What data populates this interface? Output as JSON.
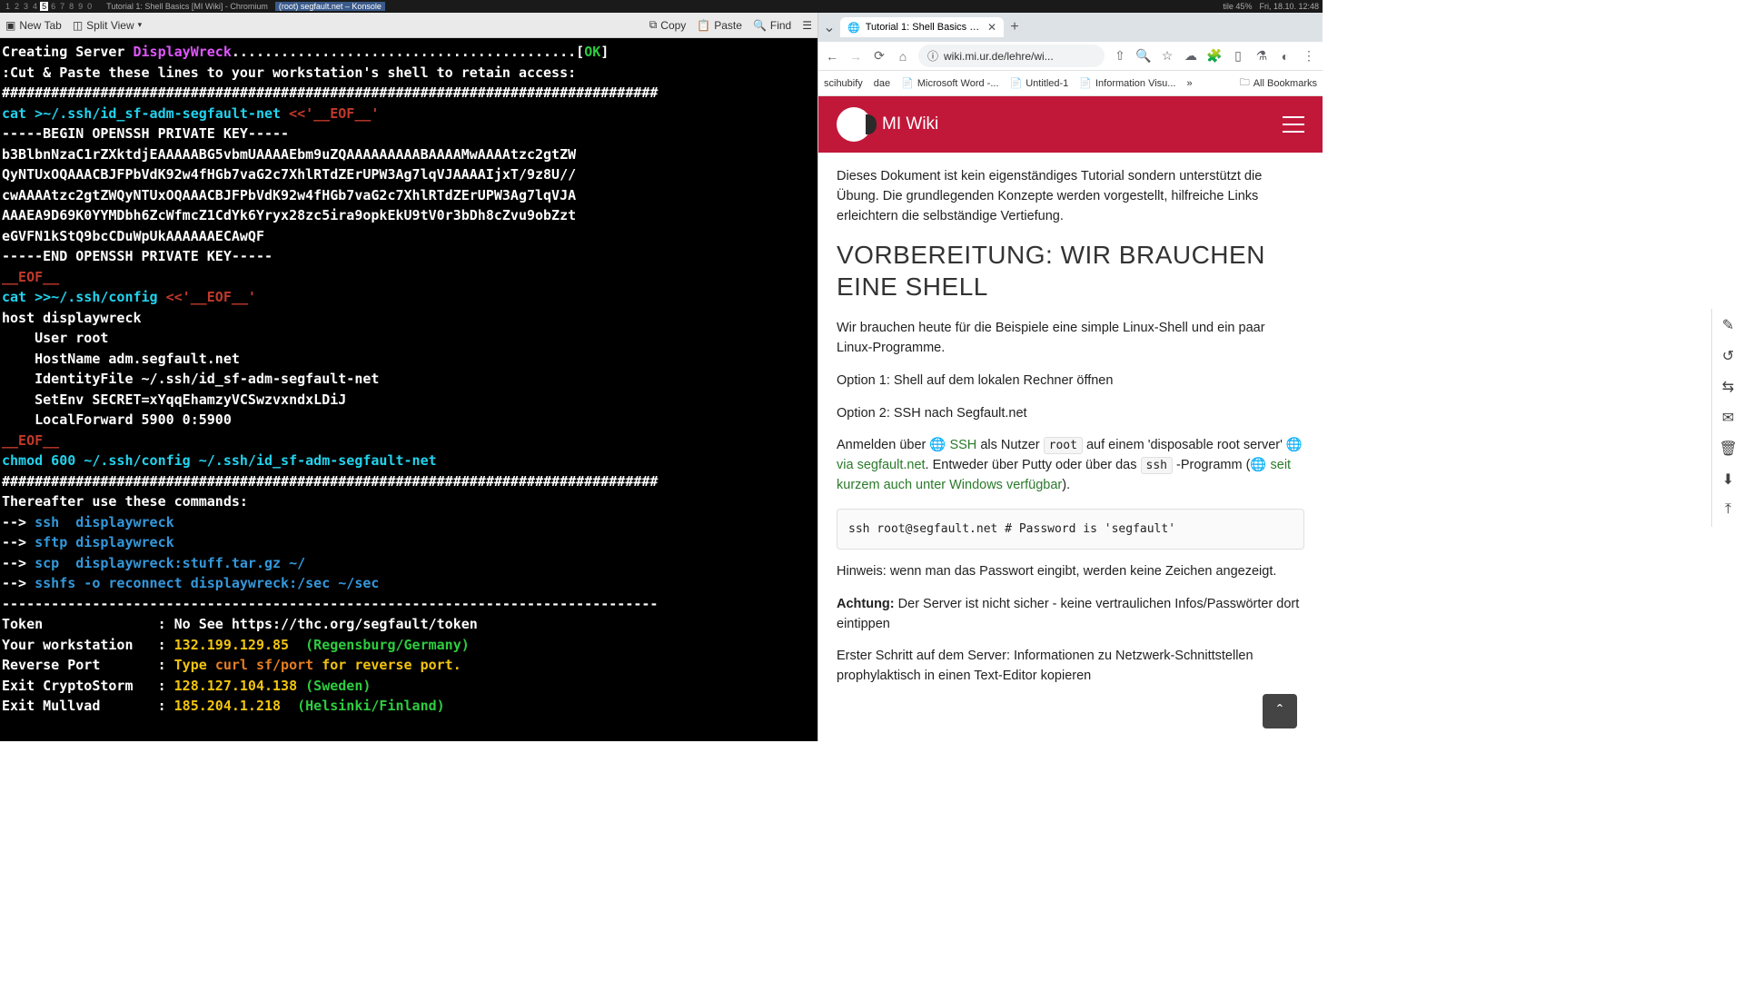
{
  "topbar": {
    "workspaces": [
      "1",
      "2",
      "3",
      "4",
      "5",
      "6",
      "7",
      "8",
      "9",
      "0"
    ],
    "active_workspace": 4,
    "tabs": [
      "Tutorial 1: Shell Basics [MI Wiki] - Chromium",
      "(root) segfault.net – Konsole"
    ],
    "right": [
      "tile 45%",
      "Fri, 18.10. 12:48"
    ]
  },
  "konsole": {
    "toolbar": {
      "new_tab": "New Tab",
      "split": "Split View",
      "copy": "Copy",
      "paste": "Paste",
      "find": "Find"
    }
  },
  "terminal": {
    "l1_a": "Creating Server ",
    "l1_b": "DisplayWreck",
    "l1_c": "..........................................[",
    "l1_d": "OK",
    "l1_e": "]",
    "l2": ":Cut & Paste these lines to your workstation's shell to retain access:",
    "hash": "################################################################################",
    "l4_a": "cat >~/.ssh/id_sf-adm-segfault-net ",
    "l4_b": "<<'__EOF__'",
    "l5": "-----BEGIN OPENSSH PRIVATE KEY-----",
    "l6": "b3BlbnNzaC1rZXktdjEAAAAABG5vbmUAAAAEbm9uZQAAAAAAAAABAAAAMwAAAAtzc2gtZW",
    "l7": "QyNTUxOQAAACBJFPbVdK92w4fHGb7vaG2c7XhlRTdZErUPW3Ag7lqVJAAAAIjxT/9z8U//",
    "l8": "cwAAAAtzc2gtZWQyNTUxOQAAACBJFPbVdK92w4fHGb7vaG2c7XhlRTdZErUPW3Ag7lqVJA",
    "l9": "AAAEA9D69K0YYMDbh6ZcWfmcZ1CdYk6Yryx28zc5ira9opkEkU9tV0r3bDh8cZvu9obZzt",
    "l10": "eGVFN1kStQ9bcCDuWpUkAAAAAAECAwQF",
    "l11": "-----END OPENSSH PRIVATE KEY-----",
    "eof": "__EOF__",
    "l13_a": "cat >>~/.ssh/config ",
    "l13_b": "<<'__EOF__'",
    "l14": "host displaywreck",
    "l15": "    User root",
    "l16": "    HostName adm.segfault.net",
    "l17": "    IdentityFile ~/.ssh/id_sf-adm-segfault-net",
    "l18": "    SetEnv SECRET=xYqqEhamzyVCSwzvxndxLDiJ",
    "l19": "    LocalForward 5900 0:5900",
    "l21": "chmod 600 ~/.ssh/config ~/.ssh/id_sf-adm-segfault-net",
    "l23": "Thereafter use these commands:",
    "arrow": "--> ",
    "l24": "ssh  displaywreck",
    "l25": "sftp displaywreck",
    "l26": "scp  displaywreck:stuff.tar.gz ~/",
    "l27": "sshfs -o reconnect displaywreck:/sec ~/sec",
    "dash": "--------------------------------------------------------------------------------",
    "token_k": "Token              : ",
    "token_v": "No See https://thc.org/segfault/token",
    "ws_k": "Your workstation   : ",
    "ws_ip": "132.199.129.85",
    "ws_loc": "  (Regensburg/Germany)",
    "rp_k": "Reverse Port       : ",
    "rp_a": "Type ",
    "rp_b": "curl sf/port",
    "rp_c": " for reverse port.",
    "ec_k": "Exit CryptoStorm   : ",
    "ec_ip": "128.127.104.138",
    "ec_loc": " (Sweden)",
    "em_k": "Exit Mullvad       : ",
    "em_ip": "185.204.1.218",
    "em_loc": "  (Helsinki/Finland)"
  },
  "browser": {
    "tab": {
      "title": "Tutorial 1: Shell Basics [MI"
    },
    "url": "wiki.mi.ur.de/lehre/wi...",
    "bookmarks": [
      "scihubify",
      "dae",
      "Microsoft Word -...",
      "Untitled-1",
      "Information Visu..."
    ],
    "all_bookmarks": "All Bookmarks"
  },
  "wiki": {
    "title": "MI Wiki",
    "intro": "Dieses Dokument ist kein eigenständiges Tutorial sondern unterstützt die Übung. Die grundlegenden Konzepte werden vorgestellt, hilfreiche Links erleichtern die selbständige Vertiefung.",
    "h2": "VORBEREITUNG: WIR BRAUCHEN EINE SHELL",
    "p1": "Wir brauchen heute für die Beispiele eine simple Linux-Shell und ein paar Linux-Programme.",
    "opt1": "Option 1: Shell auf dem lokalen Rechner öffnen",
    "opt2": "Option 2: SSH nach Segfault.net",
    "p2_a": "Anmelden über ",
    "p2_ssh": "SSH",
    "p2_b": " als Nutzer ",
    "p2_root": "root",
    "p2_c": " auf einem 'disposable root server' ",
    "p2_link1": "via segfault.net",
    "p2_d": ". Entweder über Putty oder über das ",
    "p2_sshcode": "ssh",
    "p2_e": " -Programm (",
    "p2_link2": "seit kurzem auch unter Windows verfügbar",
    "p2_f": ").",
    "code": "ssh root@segfault.net # Password is 'segfault'",
    "p3": "Hinweis: wenn man das Passwort eingibt, werden keine Zeichen angezeigt.",
    "p4_a": "Achtung:",
    "p4_b": " Der Server ist nicht sicher - keine vertraulichen Infos/Passwörter dort eintippen",
    "p5": "Erster Schritt auf dem Server: Informationen zu Netzwerk-Schnittstellen prophylaktisch in einen Text-Editor kopieren"
  }
}
